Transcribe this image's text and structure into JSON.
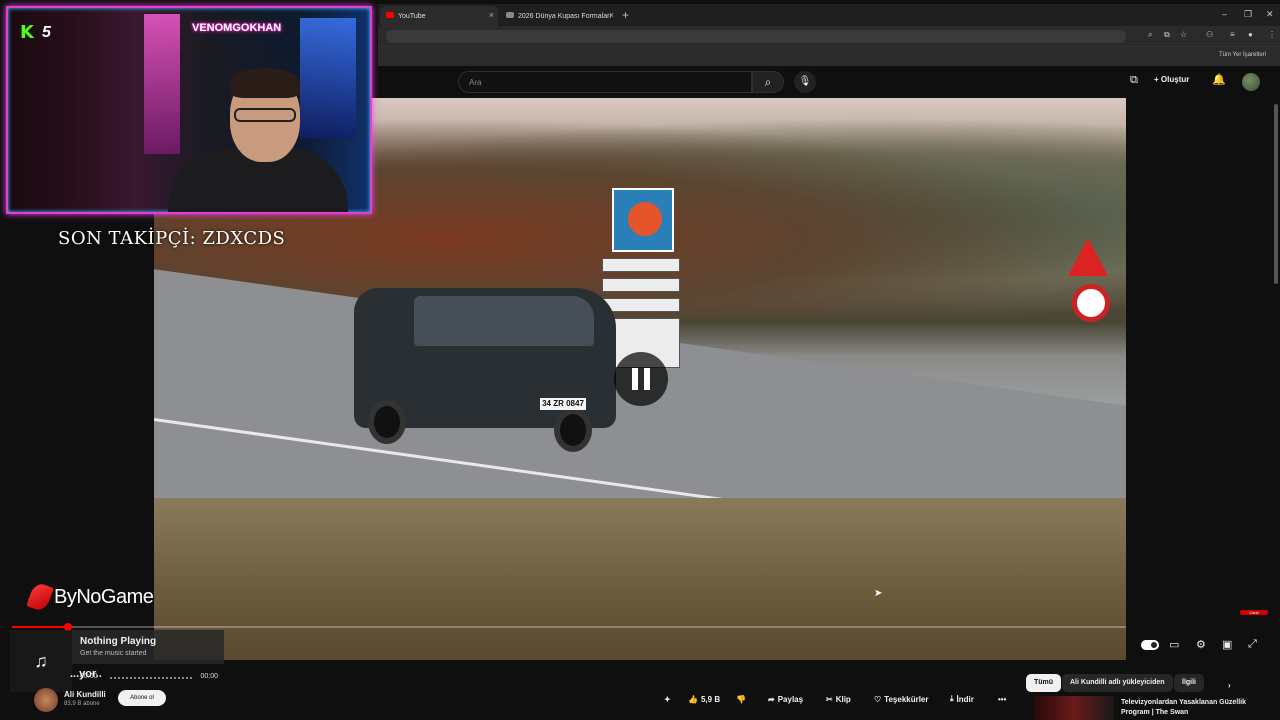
{
  "browser": {
    "tabs": [
      {
        "label": "YouTube",
        "active": true,
        "favicon_color": "#ff0000"
      },
      {
        "label": "2026 Dünya Kupası Formaları",
        "active": false,
        "favicon_color": "#888888"
      }
    ],
    "new_tab_glyph": "+",
    "bookmarks_label": "Tüm Yer İşaretleri"
  },
  "youtube_header": {
    "search_placeholder": "Ara",
    "create_label": "Oluştur"
  },
  "stream_overlay": {
    "kick_count": "5",
    "channel_name": "VENOMGOKHAN",
    "last_follower": "SON TAKİPÇİ: ZDXCDS",
    "sponsor": "ByNoGame"
  },
  "video": {
    "plate": "34 ZR 0847",
    "state": "paused",
    "progress_fraction": 0.05
  },
  "music_player": {
    "title": "Nothing Playing",
    "subtitle": "Get the music started",
    "time_current": "00:00",
    "time_total": "00:00"
  },
  "video_info": {
    "title_fragment": "...yor..",
    "channel": "Ali Kundilli",
    "subscribers": "83,9 B abone",
    "subscribe_label": "Abone ol"
  },
  "actions": {
    "likes": "5,9 B",
    "share": "Paylaş",
    "clip": "Klip",
    "thanks": "Teşekkürler",
    "download": "İndir",
    "more": "•••"
  },
  "chips": [
    "Tümü",
    "Ali Kundilli adlı yükleyiciden",
    "İlgili"
  ],
  "suggestion": {
    "title": "Televizyonlardan Yasaklanan Güzellik Program | The Swan"
  },
  "live_badge": "Canlı",
  "colors": {
    "accent": "#ff0000",
    "kick_green": "#53fc18",
    "webcam_border": "#e23fd8"
  }
}
